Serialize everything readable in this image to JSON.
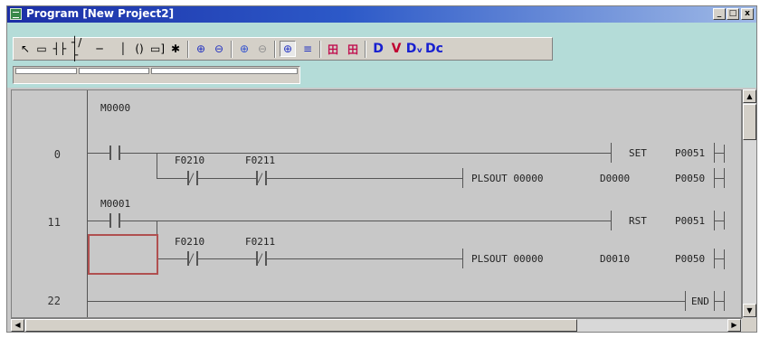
{
  "window": {
    "title": "Program  [New Project2]",
    "buttons": {
      "minimize": "_",
      "restore": "□",
      "close": "x"
    }
  },
  "toolbar": {
    "items": [
      {
        "icon": "select-arrow-icon",
        "glyph": "↖"
      },
      {
        "icon": "rectangle-select-icon",
        "glyph": "▭"
      },
      {
        "icon": "no-contact-icon",
        "glyph": "┤├"
      },
      {
        "icon": "nc-contact-icon",
        "glyph": "┤/├"
      },
      {
        "icon": "horizontal-line-icon",
        "glyph": "─"
      },
      {
        "icon": "vertical-line-icon",
        "glyph": "│"
      },
      {
        "icon": "coil-icon",
        "glyph": "()"
      },
      {
        "icon": "function-box-icon",
        "glyph": "▭]"
      },
      {
        "icon": "asterisk-icon",
        "glyph": "✱"
      },
      {
        "icon": "zoom-in-icon",
        "glyph": "⊕"
      },
      {
        "icon": "zoom-out-icon",
        "glyph": "⊖"
      },
      {
        "icon": "zoom-fit-icon",
        "glyph": "⊕"
      },
      {
        "icon": "zoom-disabled-icon",
        "glyph": "⊖"
      },
      {
        "icon": "find-icon",
        "glyph": "⊕"
      },
      {
        "icon": "list-view-icon",
        "glyph": "≡"
      },
      {
        "icon": "table-view-icon",
        "glyph": "田"
      },
      {
        "icon": "table-view-alt-icon",
        "glyph": "田"
      },
      {
        "icon": "device-d-icon",
        "glyph": "D"
      },
      {
        "icon": "device-v-icon",
        "glyph": "V"
      },
      {
        "icon": "device-dv-icon",
        "glyph": "Dᵥ"
      },
      {
        "icon": "device-dc-icon",
        "glyph": "Dc"
      }
    ]
  },
  "ladder": {
    "steps": [
      "0",
      "11",
      "22"
    ],
    "devices": {
      "m0000": "M0000",
      "f0210_a": "F0210",
      "f0211_a": "F0211",
      "m0001": "M0001",
      "f0210_b": "F0210",
      "f0211_b": "F0211"
    },
    "outputs": {
      "r1_op": "SET",
      "r1_arg": "P0051",
      "r2_op": "PLSOUT 00000",
      "r2_arg1": "D0000",
      "r2_arg2": "P0050",
      "r3_op": "RST",
      "r3_arg": "P0051",
      "r4_op": "PLSOUT 00000",
      "r4_arg1": "D0010",
      "r4_arg2": "P0050",
      "r5_op": "END"
    }
  },
  "colors": {
    "title_start": "#1c2fa6",
    "title_end": "#9fb9e6",
    "toolbar_bg": "#b4dcd8",
    "ladder_bg": "#c8c8c8",
    "cursor": "#b05050"
  }
}
